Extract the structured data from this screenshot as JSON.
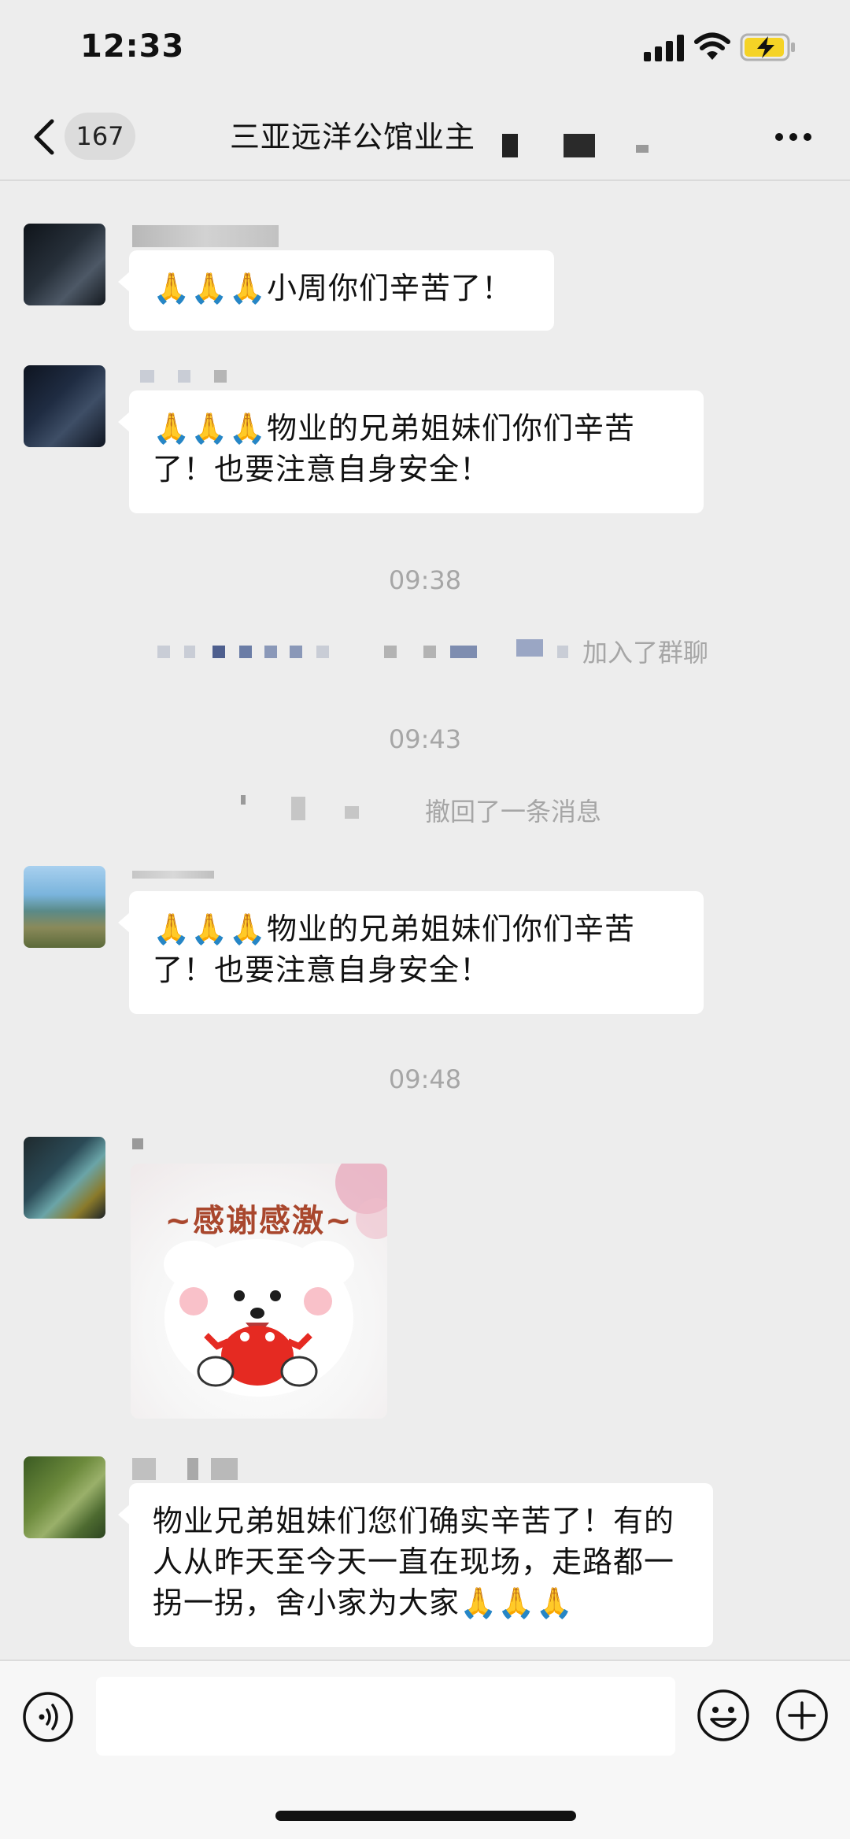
{
  "status_bar": {
    "time": "12:33"
  },
  "nav": {
    "back_count": "167",
    "title": "三亚远洋公馆业主"
  },
  "messages": [
    {
      "text": "🙏🙏🙏小周你们辛苦了！"
    },
    {
      "text": "🙏🙏🙏物业的兄弟姐妹们你们辛苦了！也要注意自身安全！"
    },
    {
      "text": "🙏🙏🙏物业的兄弟姐妹们你们辛苦了！也要注意自身安全！"
    },
    {
      "sticker_text": "~感谢感激~"
    },
    {
      "text": "物业兄弟姐妹们您们确实辛苦了！有的人从昨天至今天一直在现场，走路都一拐一拐，舍小家为大家🙏🙏🙏"
    }
  ],
  "timestamps": [
    "09:38",
    "09:43",
    "09:48"
  ],
  "system": {
    "joined": "加入了群聊",
    "recalled": "撤回了一条消息"
  },
  "colors": {
    "background": "#ededed",
    "bubble": "#ffffff",
    "meta_text": "#a6a6a6",
    "battery_fill": "#f5d326"
  },
  "icons": [
    "signal-icon",
    "wifi-icon",
    "battery-charging-icon",
    "back-chevron-icon",
    "more-icon",
    "voice-icon",
    "emoji-icon",
    "plus-icon"
  ]
}
